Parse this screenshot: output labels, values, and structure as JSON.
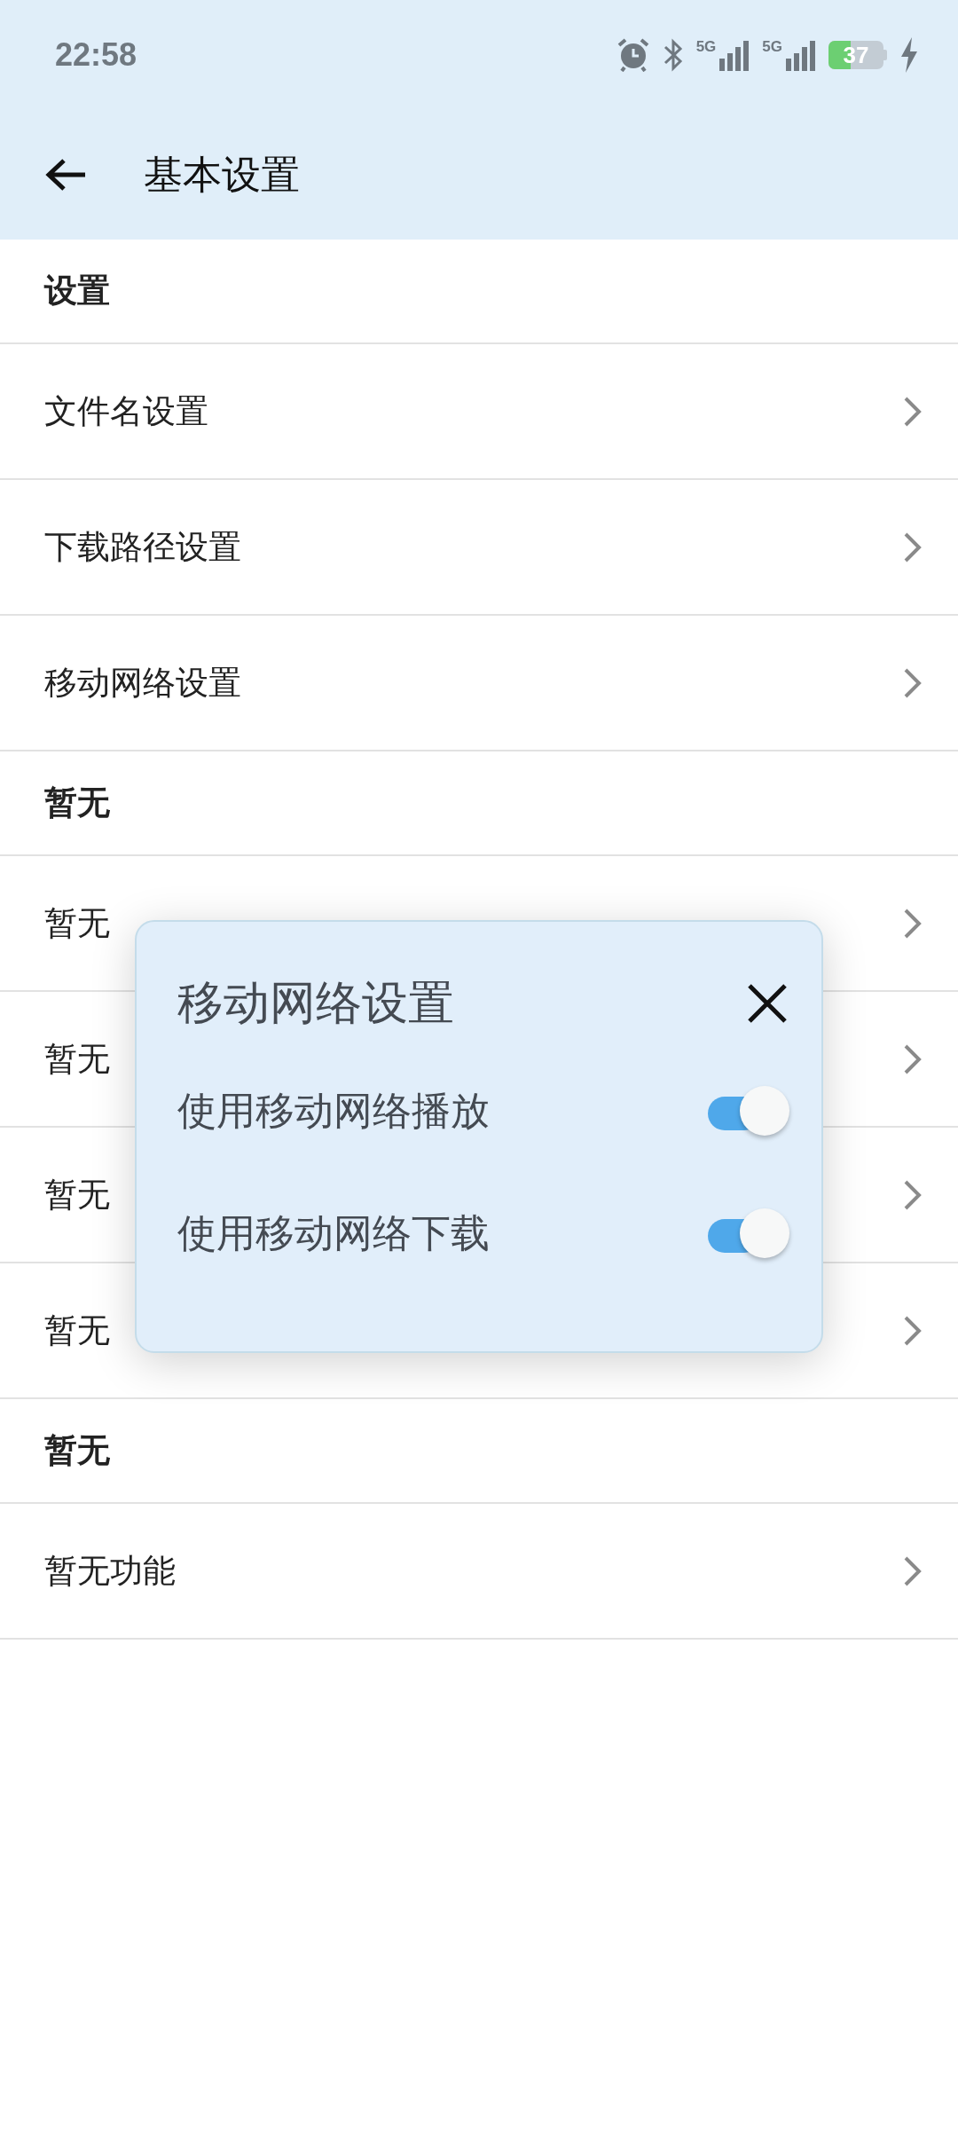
{
  "status_bar": {
    "time": "22:58",
    "network_1": "5G",
    "network_2": "5G",
    "battery": "37"
  },
  "app_bar": {
    "title": "基本设置"
  },
  "sections": [
    {
      "header": "设置",
      "items": [
        {
          "label": "文件名设置"
        },
        {
          "label": "下载路径设置"
        },
        {
          "label": "移动网络设置"
        }
      ]
    },
    {
      "header": "暂无",
      "items": [
        {
          "label": "暂无"
        },
        {
          "label": "暂无"
        },
        {
          "label": "暂无"
        },
        {
          "label": "暂无"
        }
      ]
    },
    {
      "header": "暂无",
      "items": [
        {
          "label": "暂无功能"
        }
      ]
    }
  ],
  "dialog": {
    "title": "移动网络设置",
    "toggles": [
      {
        "label": "使用移动网络播放",
        "on": true
      },
      {
        "label": "使用移动网络下载",
        "on": true
      }
    ]
  }
}
